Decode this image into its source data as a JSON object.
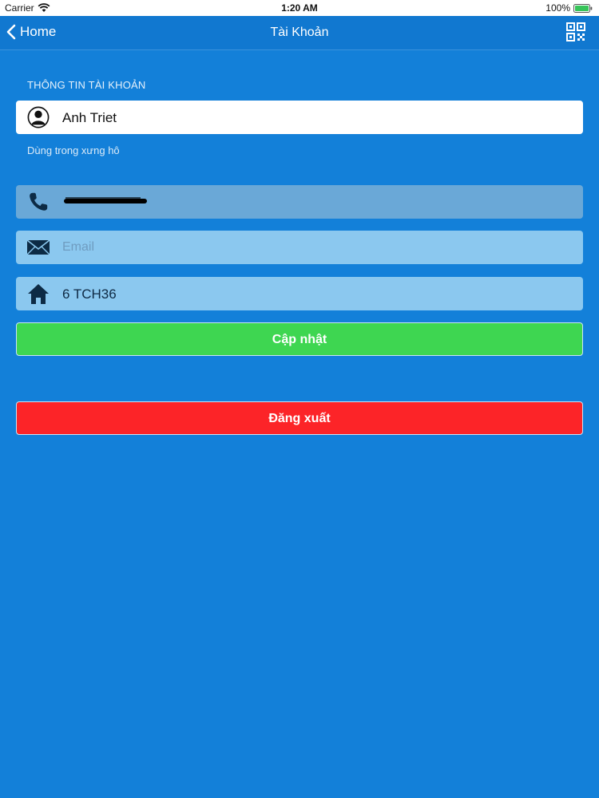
{
  "status_bar": {
    "carrier": "Carrier",
    "time": "1:20 AM",
    "battery": "100%"
  },
  "nav": {
    "back_label": "Home",
    "title": "Tài Khoản"
  },
  "section": {
    "header": "THÔNG TIN TÀI KHOẢN"
  },
  "form": {
    "name_value": "Anh Triet",
    "name_hint": "Dùng trong xưng hô",
    "email_placeholder": "Email",
    "address_value": "6 TCH36"
  },
  "buttons": {
    "update_label": "Cập nhật",
    "logout_label": "Đăng xuất"
  },
  "colors": {
    "background": "#1380d9",
    "nav_bar": "#1178d0",
    "update_button": "#3ed651",
    "logout_button": "#fc2428"
  }
}
